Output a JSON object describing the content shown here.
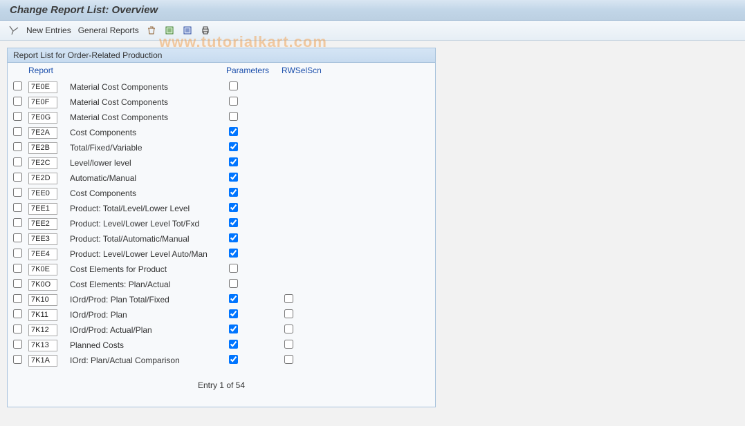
{
  "title": "Change Report List: Overview",
  "toolbar": {
    "new_entries": "New Entries",
    "general_reports": "General Reports"
  },
  "watermark": "www.tutorialkart.com",
  "panel": {
    "header": "Report List for Order-Related Production",
    "col_report": "Report",
    "col_params": "Parameters",
    "col_rw": "RWSelScn"
  },
  "rows": [
    {
      "code": "7E0E",
      "desc": "Material Cost Components",
      "param": false,
      "rw": null
    },
    {
      "code": "7E0F",
      "desc": "Material Cost Components",
      "param": false,
      "rw": null
    },
    {
      "code": "7E0G",
      "desc": "Material Cost Components",
      "param": false,
      "rw": null
    },
    {
      "code": "7E2A",
      "desc": "Cost Components",
      "param": true,
      "rw": null
    },
    {
      "code": "7E2B",
      "desc": "Total/Fixed/Variable",
      "param": true,
      "rw": null
    },
    {
      "code": "7E2C",
      "desc": "Level/lower level",
      "param": true,
      "rw": null
    },
    {
      "code": "7E2D",
      "desc": "Automatic/Manual",
      "param": true,
      "rw": null
    },
    {
      "code": "7EE0",
      "desc": "Cost Components",
      "param": true,
      "rw": null
    },
    {
      "code": "7EE1",
      "desc": "Product: Total/Level/Lower Level",
      "param": true,
      "rw": null
    },
    {
      "code": "7EE2",
      "desc": "Product: Level/Lower Level Tot/Fxd",
      "param": true,
      "rw": null
    },
    {
      "code": "7EE3",
      "desc": "Product: Total/Automatic/Manual",
      "param": true,
      "rw": null
    },
    {
      "code": "7EE4",
      "desc": "Product: Level/Lower Level Auto/Man",
      "param": true,
      "rw": null
    },
    {
      "code": "7K0E",
      "desc": "Cost Elements for Product",
      "param": false,
      "rw": null
    },
    {
      "code": "7K0O",
      "desc": "Cost Elements: Plan/Actual",
      "param": false,
      "rw": null
    },
    {
      "code": "7K10",
      "desc": "IOrd/Prod: Plan Total/Fixed",
      "param": true,
      "rw": false
    },
    {
      "code": "7K11",
      "desc": "IOrd/Prod: Plan",
      "param": true,
      "rw": false
    },
    {
      "code": "7K12",
      "desc": "IOrd/Prod: Actual/Plan",
      "param": true,
      "rw": false
    },
    {
      "code": "7K13",
      "desc": "Planned Costs",
      "param": true,
      "rw": false
    },
    {
      "code": "7K1A",
      "desc": "IOrd: Plan/Actual Comparison",
      "param": true,
      "rw": false
    }
  ],
  "status": "Entry 1 of 54"
}
